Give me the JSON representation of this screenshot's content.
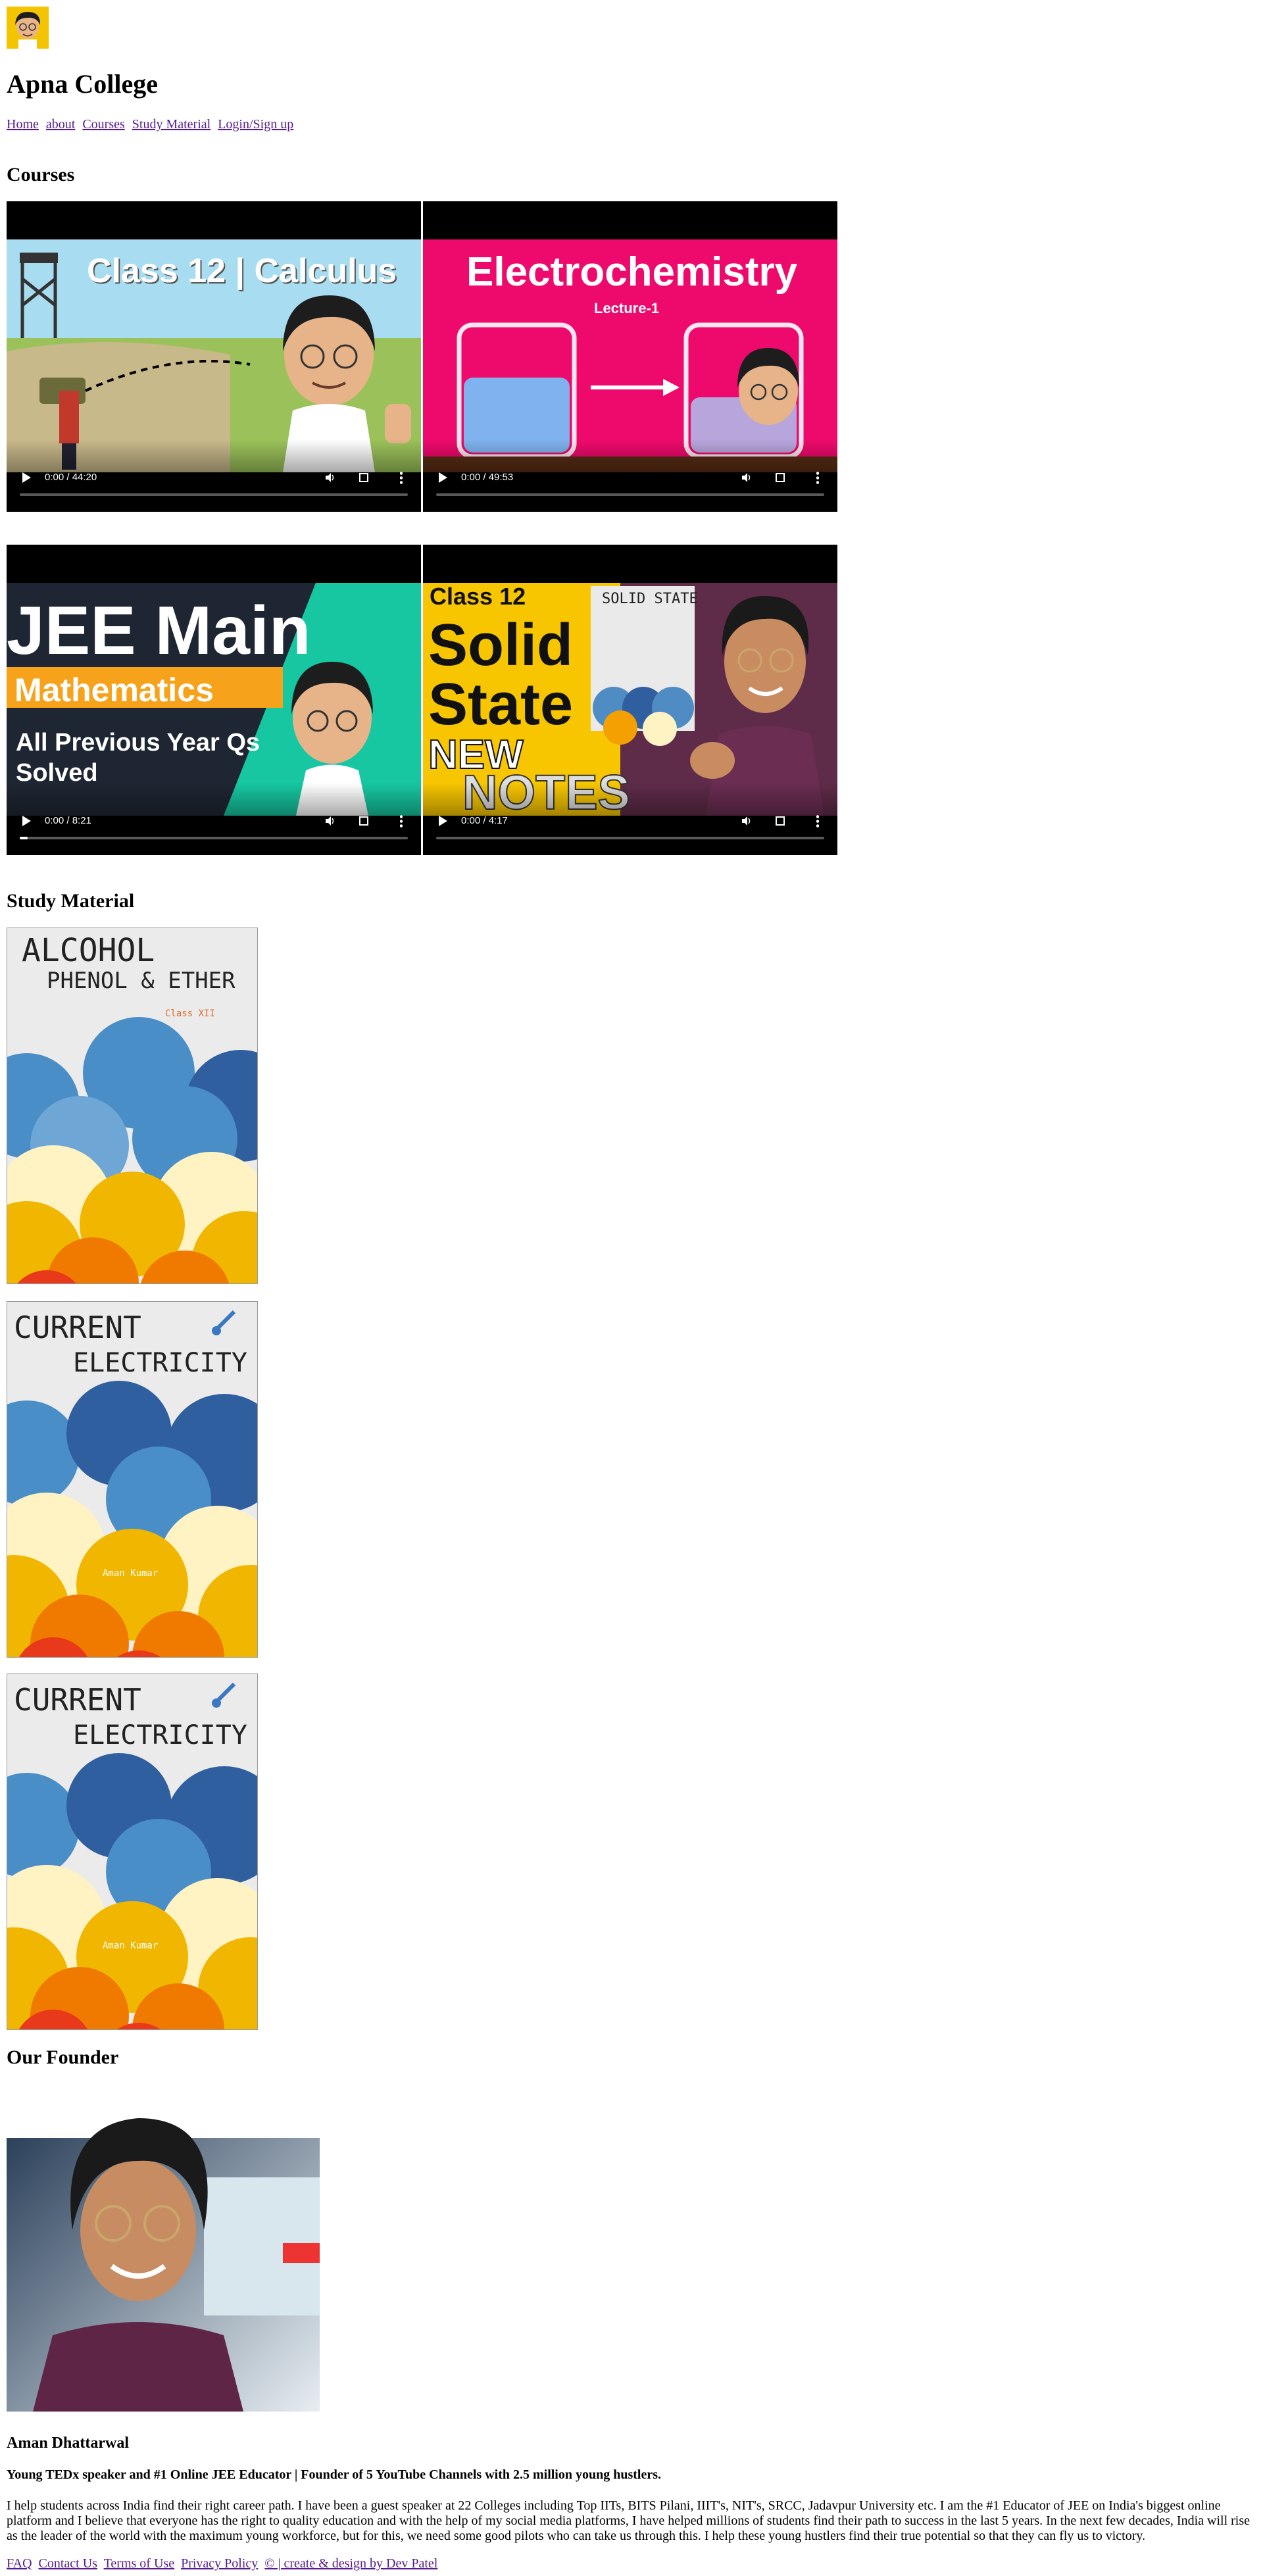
{
  "site": {
    "title": "Apna College",
    "logo_icon": "avatar-logo-icon"
  },
  "nav": {
    "items": [
      "Home",
      "about",
      "Courses",
      "Study Material",
      "Login/Sign up"
    ]
  },
  "courses": {
    "heading": "Courses",
    "videos": [
      {
        "thumb_title": "Class 12 | Calculus",
        "time": "0:00 / 44:20",
        "progress": 0
      },
      {
        "thumb_title": "Electrochemistry",
        "thumb_subtitle": "Lecture-1",
        "time": "0:00 / 49:53",
        "progress": 0
      },
      {
        "thumb_title": "JEE Main",
        "thumb_line2": "Mathematics",
        "thumb_line3": "All Previous Year Qs",
        "thumb_line4": "Solved",
        "time": "0:00 / 8:21",
        "progress": 0.02
      },
      {
        "thumb_title": "Class 12",
        "thumb_line2": "Solid",
        "thumb_line3": "State",
        "thumb_line4": "NEW",
        "thumb_line5": "NOTES",
        "thumb_badge": "SOLID STATE",
        "time": "0:00 / 4:17",
        "progress": 0
      }
    ]
  },
  "study_material": {
    "heading": "Study Material",
    "covers": [
      {
        "line1": "ALCOHOL",
        "line2": "PHENOL & ETHER",
        "note": "Class XII"
      },
      {
        "line1": "CURRENT",
        "line2": "ELECTRICITY",
        "note": "Aman Kumar"
      },
      {
        "line1": "CURRENT",
        "line2": "ELECTRICITY",
        "note": "Aman Kumar"
      }
    ]
  },
  "founder": {
    "heading": "Our Founder",
    "name": "Aman Dhattarwal",
    "tagline": "Young TEDx speaker and #1 Online JEE Educator | Founder of 5 YouTube Channels with 2.5 million young hustlers.",
    "bio": "I help students across India find their right career path. I have been a guest speaker at 22 Colleges including Top IITs, BITS Pilani, IIIT's, NIT's, SRCC, Jadavpur University etc. I am the #1 Educator of JEE on India's biggest online platform and I believe that everyone has the right to quality education and with the help of my social media platforms, I have helped millions of students find their path to success in the last 5 years. In the next few decades, India will rise as the leader of the world with the maximum young workforce, but for this, we need some good pilots who can take us through this. I help these young hustlers find their true potential so that they can fly us to victory."
  },
  "footer": {
    "links": [
      "FAQ",
      "Contact Us",
      "Terms of Use",
      "Privacy Policy",
      "© | create & design by Dev Patel"
    ]
  }
}
